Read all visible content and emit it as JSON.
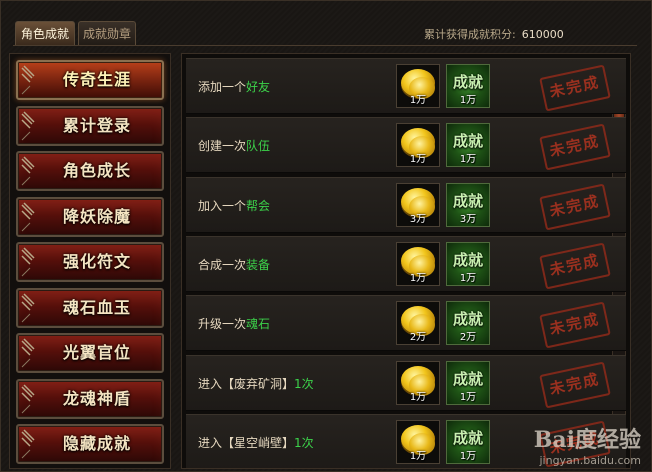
{
  "tabs": [
    {
      "label": "角色成就",
      "active": true
    },
    {
      "label": "成就勋章",
      "active": false
    }
  ],
  "points": {
    "label": "累计获得成就积分:",
    "value": "610000"
  },
  "sidebar": {
    "items": [
      {
        "label": "传奇生涯",
        "active": true
      },
      {
        "label": "累计登录",
        "active": false
      },
      {
        "label": "角色成长",
        "active": false
      },
      {
        "label": "降妖除魔",
        "active": false
      },
      {
        "label": "强化符文",
        "active": false
      },
      {
        "label": "魂石血玉",
        "active": false
      },
      {
        "label": "光翼官位",
        "active": false
      },
      {
        "label": "龙魂神盾",
        "active": false
      },
      {
        "label": "隐藏成就",
        "active": false
      }
    ]
  },
  "achievements": [
    {
      "prefix": "添加一个",
      "highlight": "好友",
      "suffix": "",
      "gold": "1万",
      "badge": "成就",
      "points": "1万",
      "status": "未完成"
    },
    {
      "prefix": "创建一次",
      "highlight": "队伍",
      "suffix": "",
      "gold": "1万",
      "badge": "成就",
      "points": "1万",
      "status": "未完成"
    },
    {
      "prefix": "加入一个",
      "highlight": "帮会",
      "suffix": "",
      "gold": "3万",
      "badge": "成就",
      "points": "3万",
      "status": "未完成"
    },
    {
      "prefix": "合成一次",
      "highlight": "装备",
      "suffix": "",
      "gold": "1万",
      "badge": "成就",
      "points": "1万",
      "status": "未完成"
    },
    {
      "prefix": "升级一次",
      "highlight": "魂石",
      "suffix": "",
      "gold": "2万",
      "badge": "成就",
      "points": "2万",
      "status": "未完成"
    },
    {
      "prefix": "进入【废弃矿洞】",
      "highlight": "1次",
      "suffix": "",
      "gold": "1万",
      "badge": "成就",
      "points": "1万",
      "status": "未完成"
    },
    {
      "prefix": "进入【星空峭壁】",
      "highlight": "1次",
      "suffix": "",
      "gold": "1万",
      "badge": "成就",
      "points": "1万",
      "status": "未完成"
    }
  ],
  "watermark": {
    "brand": "Bai度经验",
    "url": "jingyan.baidu.com"
  },
  "colors": {
    "accent": "#3cd24a",
    "stamp": "#b03420",
    "sidebar_red": "#7a1a12"
  }
}
